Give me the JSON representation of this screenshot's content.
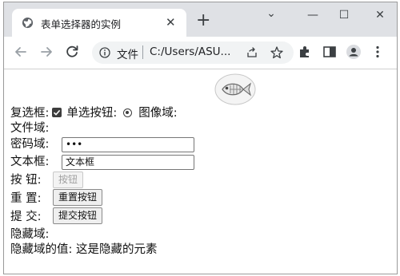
{
  "browser": {
    "tab_title": "表单选择器的实例",
    "tab_close": "✕",
    "new_tab": "+",
    "url_label": "文件",
    "url_text": "C:/Users/ASU...",
    "window_minimize": "—",
    "window_restore": "☐",
    "window_close": "✕",
    "tab_search": "⌄"
  },
  "form": {
    "checkbox_label": "复选框:",
    "radio_label": "单选按钮:",
    "image_label": "图像域:",
    "file_label": "文件域:",
    "password_label": "密码域:",
    "password_value": "•••",
    "text_label": "文本框:",
    "text_value": "文本框",
    "button_label": "按 钮:",
    "button_text": "按钮",
    "reset_label": "重 置:",
    "reset_text": "重置按钮",
    "submit_label": "提 交:",
    "submit_text": "提交按钮",
    "hidden_label": "隐藏域:",
    "hidden_value_line": "隐藏域的值: 这是隐藏的元素"
  },
  "colors": {
    "tabstrip": "#dfe1e5",
    "omnibox": "#f1f3f4"
  }
}
